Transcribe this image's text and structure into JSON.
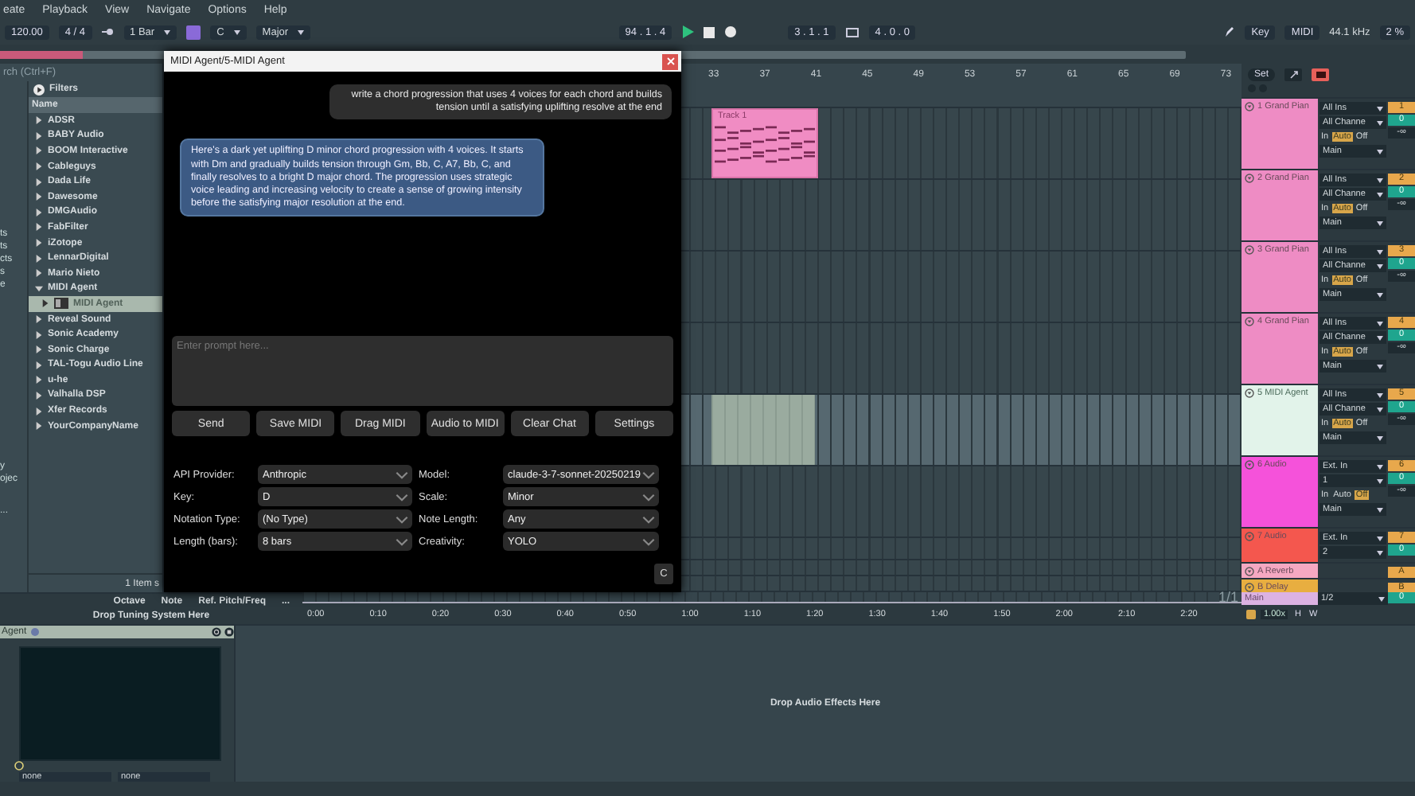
{
  "menu": [
    "eate",
    "Playback",
    "View",
    "Navigate",
    "Options",
    "Help"
  ],
  "toolbar": {
    "tempo": "120.00",
    "time_signature": "4 / 4",
    "quantization": "1 Bar",
    "key": "C",
    "scale": "Major",
    "position": "94 . 1 . 4",
    "loop_start": "3 . 1 . 1",
    "loop_length": "4 . 0 . 0",
    "key_button": "Key",
    "midi_button": "MIDI",
    "sample_rate": "44.1 kHz",
    "cpu": "2 %"
  },
  "browser": {
    "search_placeholder": "rch (Ctrl+F)",
    "collections": [
      [
        "ts",
        "ts",
        "cts",
        "s",
        "e"
      ],
      [
        "y",
        "ojec"
      ],
      [
        "..."
      ]
    ],
    "filters": "Filters",
    "header": "Name",
    "footer": "1 Item s",
    "items": [
      {
        "label": "ADSR",
        "expanded": false
      },
      {
        "label": "BABY Audio",
        "expanded": false
      },
      {
        "label": "BOOM Interactive",
        "expanded": false
      },
      {
        "label": "Cableguys",
        "expanded": false
      },
      {
        "label": "Dada Life",
        "expanded": false
      },
      {
        "label": "Dawesome",
        "expanded": false
      },
      {
        "label": "DMGAudio",
        "expanded": false
      },
      {
        "label": "FabFilter",
        "expanded": false
      },
      {
        "label": "iZotope",
        "expanded": false
      },
      {
        "label": "LennarDigital",
        "expanded": false
      },
      {
        "label": "Mario Nieto",
        "expanded": false
      },
      {
        "label": "MIDI Agent",
        "expanded": true,
        "children": [
          {
            "label": "MIDI Agent",
            "selected": true
          }
        ]
      },
      {
        "label": "Reveal Sound",
        "expanded": false
      },
      {
        "label": "Sonic Academy",
        "expanded": false
      },
      {
        "label": "Sonic Charge",
        "expanded": false
      },
      {
        "label": "TAL-Togu Audio Line",
        "expanded": false
      },
      {
        "label": "u-he",
        "expanded": false
      },
      {
        "label": "Valhalla DSP",
        "expanded": false
      },
      {
        "label": "Xfer Records",
        "expanded": false
      },
      {
        "label": "YourCompanyName",
        "expanded": false
      }
    ]
  },
  "dialog": {
    "title": "MIDI Agent/5-MIDI Agent",
    "messages": [
      {
        "kind": "user",
        "text": "write a chord progression that uses 4 voices for each chord and builds tension until a satisfying uplifting resolve at the end"
      },
      {
        "kind": "assistant",
        "text": "Here's a dark yet uplifting D minor chord progression with 4 voices. It starts with Dm and gradually builds tension through Gm, Bb, C, A7, Bb, C, and finally resolves to a bright D major chord. The progression uses strategic voice leading and increasing velocity to create a sense of growing intensity before the satisfying major resolution at the end."
      }
    ],
    "prompt_placeholder": "Enter prompt here...",
    "buttons": [
      "Send",
      "Save MIDI",
      "Drag MIDI",
      "Audio to MIDI",
      "Clear Chat",
      "Settings"
    ],
    "settings": [
      {
        "label": "API Provider:",
        "value": "Anthropic"
      },
      {
        "label": "Model:",
        "value": "claude-3-7-sonnet-20250219"
      },
      {
        "label": "Key:",
        "value": "D"
      },
      {
        "label": "Scale:",
        "value": "Minor"
      },
      {
        "label": "Notation Type:",
        "value": "(No Type)"
      },
      {
        "label": "Note Length:",
        "value": "Any"
      },
      {
        "label": "Length (bars):",
        "value": "8 bars"
      },
      {
        "label": "Creativity:",
        "value": "YOLO"
      }
    ],
    "corner_button": "C"
  },
  "arrangement": {
    "ruler": [
      "33",
      "37",
      "41",
      "45",
      "49",
      "53",
      "57",
      "61",
      "65",
      "69",
      "73"
    ],
    "set_button": "Set",
    "clip": {
      "name": "Track 1"
    },
    "tracks": [
      {
        "kind": "midi",
        "name": "1 Grand Pian",
        "color": "#ee8cc4",
        "selected": false,
        "input": "All Ins",
        "channel": "All Channe",
        "monitor": [
          {
            "label": "In",
            "selected": false
          },
          {
            "label": "Auto",
            "selected": true
          },
          {
            "label": "Off",
            "selected": false
          }
        ],
        "output": "Main",
        "number": "1",
        "volume": "0",
        "send": "-∞"
      },
      {
        "kind": "midi",
        "name": "2 Grand Pian",
        "color": "#ee8cc4",
        "selected": false,
        "input": "All Ins",
        "channel": "All Channe",
        "monitor": [
          {
            "label": "In",
            "selected": false
          },
          {
            "label": "Auto",
            "selected": true
          },
          {
            "label": "Off",
            "selected": false
          }
        ],
        "output": "Main",
        "number": "2",
        "volume": "0",
        "send": "-∞"
      },
      {
        "kind": "midi",
        "name": "3 Grand Pian",
        "color": "#ee8cc4",
        "selected": false,
        "input": "All Ins",
        "channel": "All Channe",
        "monitor": [
          {
            "label": "In",
            "selected": false
          },
          {
            "label": "Auto",
            "selected": true
          },
          {
            "label": "Off",
            "selected": false
          }
        ],
        "output": "Main",
        "number": "3",
        "volume": "0",
        "send": "-∞"
      },
      {
        "kind": "midi",
        "name": "4 Grand Pian",
        "color": "#ee8cc4",
        "selected": false,
        "input": "All Ins",
        "channel": "All Channe",
        "monitor": [
          {
            "label": "In",
            "selected": false
          },
          {
            "label": "Auto",
            "selected": true
          },
          {
            "label": "Off",
            "selected": false
          }
        ],
        "output": "Main",
        "number": "4",
        "volume": "0",
        "send": "-∞"
      },
      {
        "kind": "midi",
        "name": "5 MIDI Agent",
        "color": "#e2f3ea",
        "selected": true,
        "input": "All Ins",
        "channel": "All Channe",
        "monitor": [
          {
            "label": "In",
            "selected": false
          },
          {
            "label": "Auto",
            "selected": true
          },
          {
            "label": "Off",
            "selected": false
          }
        ],
        "output": "Main",
        "number": "5",
        "volume": "0",
        "send": "-∞"
      },
      {
        "kind": "audio",
        "name": "6 Audio",
        "color": "#f552da",
        "selected": false,
        "input": "Ext. In",
        "channel": "1",
        "monitor": [
          {
            "label": "In",
            "selected": false
          },
          {
            "label": "Auto",
            "selected": false
          },
          {
            "label": "Off",
            "selected": true
          }
        ],
        "output": "Main",
        "number": "6",
        "volume": "0",
        "send": "-∞"
      },
      {
        "kind": "short",
        "name": "7 Audio",
        "color": "#f4574e",
        "selected": false,
        "input": "Ext. In",
        "channel": "2",
        "number": "7",
        "volume": "0"
      },
      {
        "kind": "return",
        "name": "A Reverb",
        "color": "#f5a8c2",
        "selected": false,
        "number": "A"
      },
      {
        "kind": "return",
        "name": "B Delay",
        "color": "#e8ae40",
        "selected": false,
        "number": "B"
      }
    ]
  },
  "bottom": {
    "tuning_columns": [
      "Octave",
      "Note",
      "Ref. Pitch/Freq",
      "..."
    ],
    "tuning_drop": "Drop Tuning System Here",
    "page": "1/1",
    "timeline": [
      "0:00",
      "0:10",
      "0:20",
      "0:30",
      "0:40",
      "0:50",
      "1:00",
      "1:10",
      "1:20",
      "1:30",
      "1:40",
      "1:50",
      "2:00",
      "2:10",
      "2:20"
    ],
    "main_track": {
      "name": "Main",
      "color": "#dcb2e2",
      "output": "1/2",
      "volume": "0"
    },
    "zoom": "1.00x",
    "h_button": "H",
    "w_button": "W"
  },
  "device": {
    "title": "Agent",
    "fields": [
      "none",
      "none"
    ],
    "drop_text": "Drop Audio Effects Here"
  }
}
